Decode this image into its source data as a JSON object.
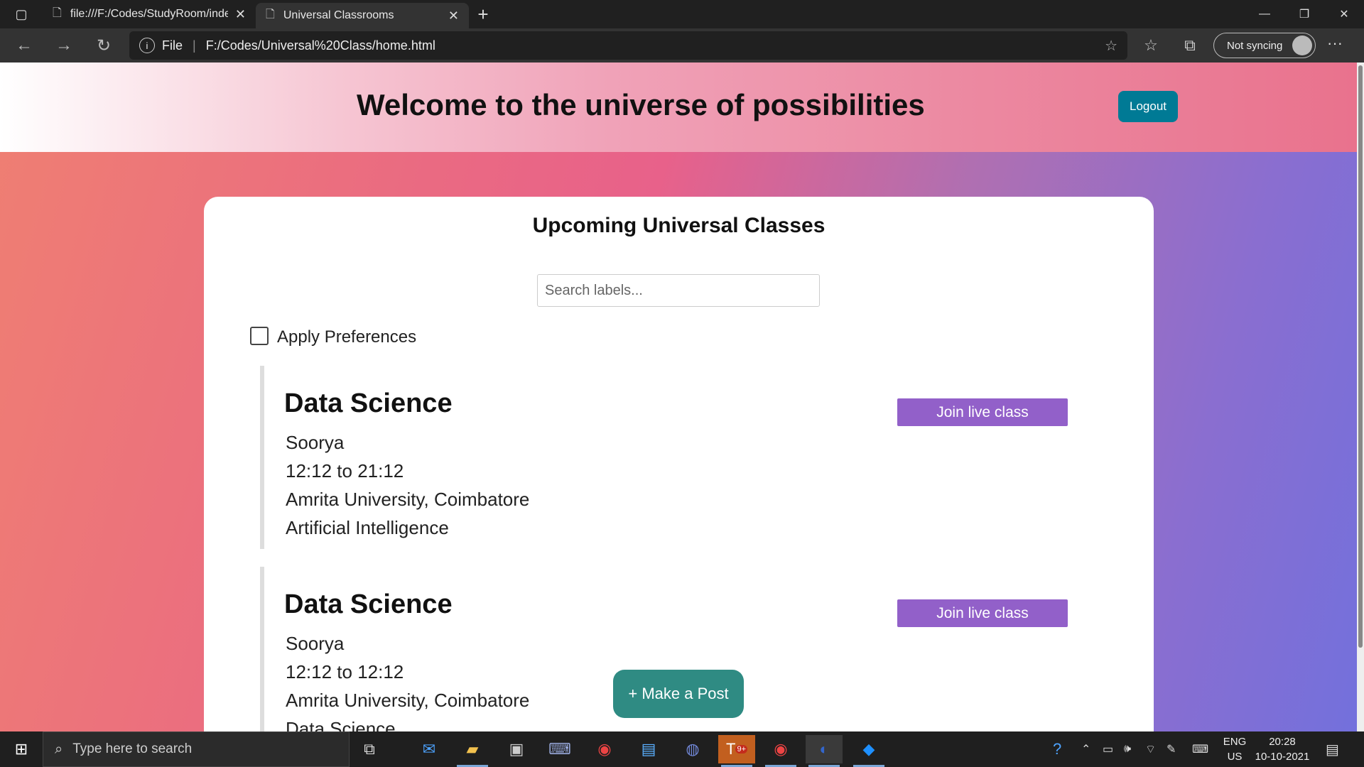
{
  "browser": {
    "tabs": [
      {
        "title": "file:///F:/Codes/StudyRoom/inde",
        "active": false
      },
      {
        "title": "Universal Classrooms",
        "active": true
      }
    ],
    "address_scheme": "File",
    "address_url": "F:/Codes/Universal%20Class/home.html",
    "sync_label": "Not syncing"
  },
  "header": {
    "title": "Welcome to the universe of possibilities",
    "logout_label": "Logout"
  },
  "main": {
    "heading": "Upcoming Universal Classes",
    "search_placeholder": "Search labels...",
    "preferences_label": "Apply Preferences",
    "join_label": "Join live class",
    "classes": [
      {
        "title": "Data Science",
        "teacher": "Soorya",
        "time": "12:12 to 21:12",
        "institution": "Amrita University, Coimbatore",
        "label": "Artificial Intelligence"
      },
      {
        "title": "Data Science",
        "teacher": "Soorya",
        "time": "12:12 to 12:12",
        "institution": "Amrita University, Coimbatore",
        "label": "Data Science"
      }
    ],
    "post_button_label": "+ Make a Post"
  },
  "taskbar": {
    "search_placeholder": "Type here to search",
    "lang_top": "ENG",
    "lang_bottom": "US",
    "time": "20:28",
    "date": "10-10-2021",
    "teams_badge": "9+"
  },
  "colors": {
    "logout": "#007a95",
    "join": "#9260c9",
    "post": "#2f8b83"
  }
}
